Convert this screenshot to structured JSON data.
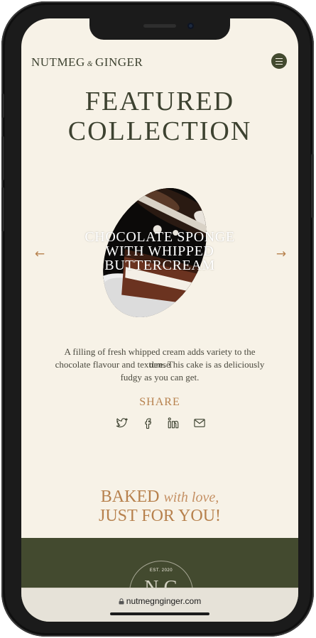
{
  "header": {
    "logo_left": "NUTMEG",
    "logo_amp": "&",
    "logo_right": "GINGER",
    "menu_icon": "hamburger-menu-icon"
  },
  "page": {
    "title_line1": "FEATURED",
    "title_line2": "COLLECTION"
  },
  "carousel": {
    "prev_icon": "←",
    "next_icon": "→",
    "caption_line1": "CHOCOLATE SPONGE",
    "caption_line2": "WITH WHIPPED",
    "caption_line3": "BUTTERCREAM",
    "description_line1": "A filling of fresh whipped cream adds variety to the dense",
    "description_line2": "chocolate flavour and texture. This cake is as deliciously",
    "description_line3": "fudgy as you can get."
  },
  "share": {
    "label": "SHARE",
    "icons": [
      "twitter-icon",
      "facebook-icon",
      "linkedin-icon",
      "mail-icon"
    ]
  },
  "baked": {
    "line1_main": "BAKED",
    "line1_script": "with love,",
    "line2": "JUST FOR YOU!"
  },
  "footer_badge": {
    "est": "EST. 2020",
    "monogram": "N  G"
  },
  "browser": {
    "url": "nutmegnginger.com"
  },
  "colors": {
    "background": "#f7f2e7",
    "olive": "#434a2f",
    "accent": "#b7814d",
    "text": "#3d4230"
  }
}
